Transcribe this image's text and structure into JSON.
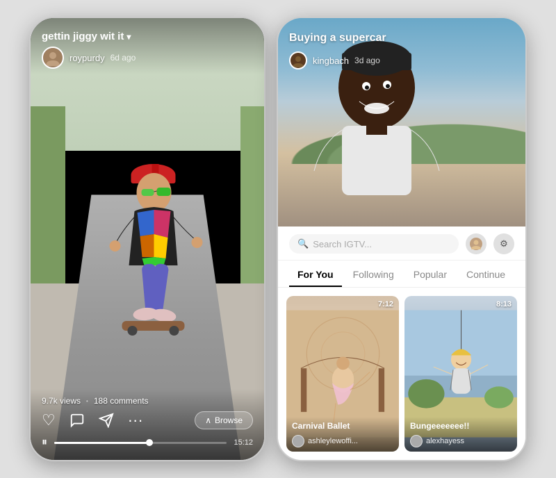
{
  "leftPhone": {
    "videoTitle": "gettin jiggy wit it",
    "dropdownIcon": "▾",
    "user": {
      "name": "roypurdy",
      "timeAgo": "6d ago"
    },
    "stats": {
      "views": "9.7k views",
      "comments": "188 comments"
    },
    "actions": {
      "likeIcon": "♡",
      "commentIcon": "💬",
      "shareIcon": "✈",
      "moreIcon": "···",
      "browseLabel": "Browse",
      "browseIcon": "∧"
    },
    "player": {
      "playIcon": "⏸",
      "duration": "15:12"
    }
  },
  "rightPhone": {
    "videoTitle": "Buying a supercar",
    "user": {
      "name": "kingbach",
      "timeAgo": "3d ago"
    },
    "search": {
      "placeholder": "Search IGTV..."
    },
    "tabs": [
      {
        "label": "For You",
        "active": true
      },
      {
        "label": "Following",
        "active": false
      },
      {
        "label": "Popular",
        "active": false
      },
      {
        "label": "Continue",
        "active": false
      }
    ],
    "thumbnails": [
      {
        "title": "Carnival Ballet",
        "user": "ashleylewoffi...",
        "duration": "7:12",
        "bgClass": "thumb-bg-1"
      },
      {
        "title": "Bungeeeeeee!!",
        "user": "alexhayess",
        "duration": "8:13",
        "bgClass": "thumb-bg-2"
      }
    ]
  }
}
